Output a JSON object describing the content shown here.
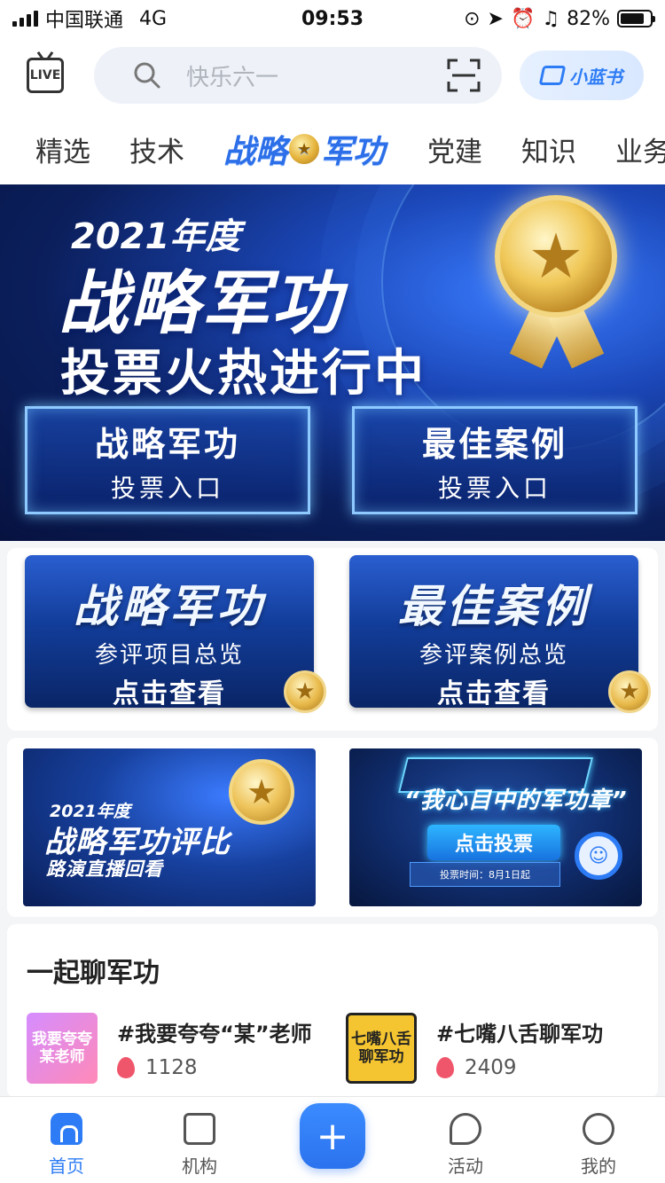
{
  "status_bar": {
    "carrier": "中国联通",
    "network": "4G",
    "time": "09:53",
    "battery": "82%",
    "battery_level": 0.82
  },
  "header": {
    "live_label": "LIVE",
    "search_placeholder": "快乐六一",
    "xlsb_label": "小蓝书"
  },
  "tabs": {
    "items": [
      "精选",
      "技术",
      "战略军功",
      "党建",
      "知识",
      "业务"
    ]
  },
  "hero": {
    "year": "2021年度",
    "title": "战略军功",
    "subtitle": "投票火热进行中",
    "buttons": [
      {
        "title": "战略军功",
        "label": "投票入口"
      },
      {
        "title": "最佳案例",
        "label": "投票入口"
      }
    ]
  },
  "cards": [
    {
      "title": "战略军功",
      "subtitle": "参评项目总览",
      "action": "点击查看"
    },
    {
      "title": "最佳案例",
      "subtitle": "参评案例总览",
      "action": "点击查看"
    }
  ],
  "banners": {
    "replay": {
      "year": "2021年度",
      "title": "战略军功评比",
      "subtitle": "路演直播回看"
    },
    "vote": {
      "title": "“我心目中的军功章”",
      "button": "点击投票",
      "time": "投票时间：8月1日起"
    }
  },
  "topics": {
    "title": "一起聊军功",
    "items": [
      {
        "thumb": "我要夸夸某老师",
        "name": "#我要夸夸“某”老师",
        "count": "1128"
      },
      {
        "thumb": "七嘴八舌聊军功",
        "name": "#七嘴八舌聊军功",
        "count": "2409"
      }
    ]
  },
  "bottom_nav": {
    "items": [
      {
        "label": "首页",
        "icon": "home-icon",
        "active": true
      },
      {
        "label": "机构",
        "icon": "org-icon"
      },
      {
        "label": "",
        "icon": "plus-icon"
      },
      {
        "label": "活动",
        "icon": "activity-icon"
      },
      {
        "label": "我的",
        "icon": "profile-icon"
      }
    ]
  },
  "colors": {
    "accent": "#2d7cf5",
    "hot": "#f0566b"
  }
}
